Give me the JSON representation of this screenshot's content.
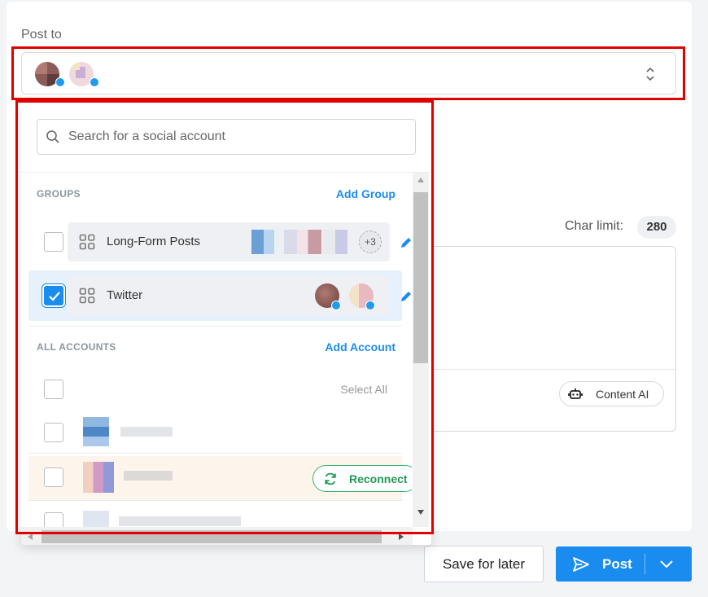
{
  "post_to": {
    "label": "Post to",
    "selected_accounts": [
      {
        "icon": "avatar-twitter-1",
        "network": "twitter"
      },
      {
        "icon": "avatar-twitter-2",
        "network": "twitter"
      }
    ]
  },
  "dropdown": {
    "search": {
      "placeholder": "Search for a social account",
      "value": ""
    },
    "groups": {
      "title": "GROUPS",
      "add_label": "Add Group",
      "items": [
        {
          "name": "Long-Form Posts",
          "checked": false,
          "more_count": "+3"
        },
        {
          "name": "Twitter",
          "checked": true
        }
      ]
    },
    "accounts": {
      "title": "ALL ACCOUNTS",
      "add_label": "Add Account",
      "select_all_label": "Select All",
      "reconnect_label": "Reconnect"
    }
  },
  "editor": {
    "char_limit_label": "Char limit:",
    "char_limit_value": "280",
    "content_ai_label": "Content AI"
  },
  "footer": {
    "save_later_label": "Save for later",
    "post_label": "Post"
  },
  "colors": {
    "accent": "#1a8cf0",
    "highlight": "#e00000",
    "reconnect": "#34b36b",
    "twitter": "#1d9bf0"
  }
}
